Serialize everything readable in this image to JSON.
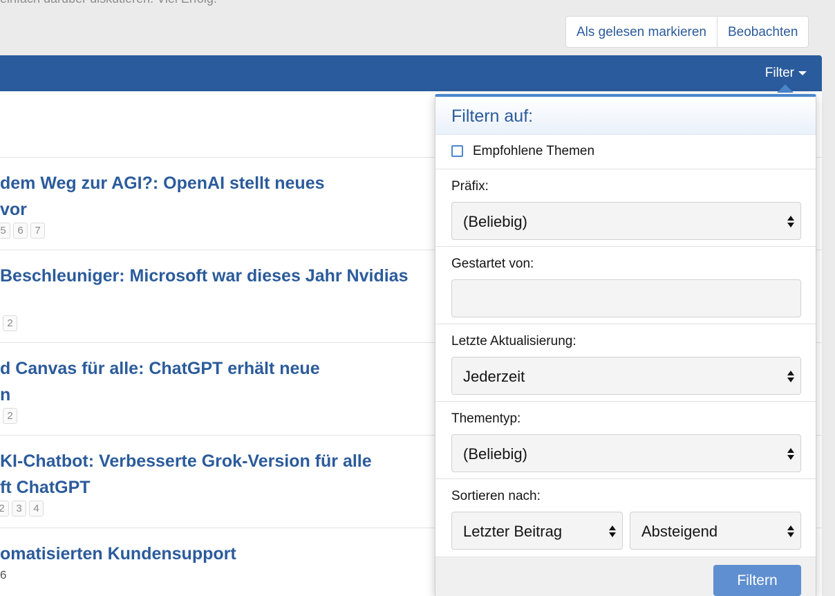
{
  "intro": {
    "text": "einfach darüber diskutieren. Viel Erfolg!"
  },
  "top_buttons": {
    "mark_read": "Als gelesen markieren",
    "watch": "Beobachten"
  },
  "blockbar": {
    "filter_toggle": "Filter"
  },
  "threads": [
    {
      "title_lines": [
        "dem Weg zur AGI?: OpenAI stellt neues",
        "vor"
      ],
      "pages": [
        "5",
        "6",
        "7"
      ]
    },
    {
      "title_lines": [
        "Beschleuniger: Microsoft war dieses Jahr Nvidias",
        ""
      ],
      "pages": [
        "2"
      ]
    },
    {
      "title_lines": [
        "d Canvas für alle: ChatGPT erhält neue",
        "n"
      ],
      "pages": [
        "2"
      ]
    },
    {
      "title_lines": [
        "KI-Chatbot: Verbesserte Grok-Version für alle",
        "ft ChatGPT"
      ],
      "pages": [
        "2",
        "3",
        "4"
      ]
    },
    {
      "title_lines": [
        "omatisierten Kundensupport"
      ],
      "meta": "6"
    }
  ],
  "filter_menu": {
    "header": "Filtern auf:",
    "featured_label": "Empfohlene Themen",
    "prefix_label": "Präfix:",
    "prefix_value": "(Beliebig)",
    "started_by_label": "Gestartet von:",
    "started_by_value": "",
    "last_update_label": "Letzte Aktualisierung:",
    "last_update_value": "Jederzeit",
    "thread_type_label": "Thementyp:",
    "thread_type_value": "(Beliebig)",
    "sort_label": "Sortieren nach:",
    "sort_by_value": "Letzter Beitrag",
    "sort_dir_value": "Absteigend",
    "submit_label": "Filtern"
  },
  "colors": {
    "accent": "#2a5b9c",
    "link": "#2b5b9b",
    "button": "#5f8fd0"
  }
}
